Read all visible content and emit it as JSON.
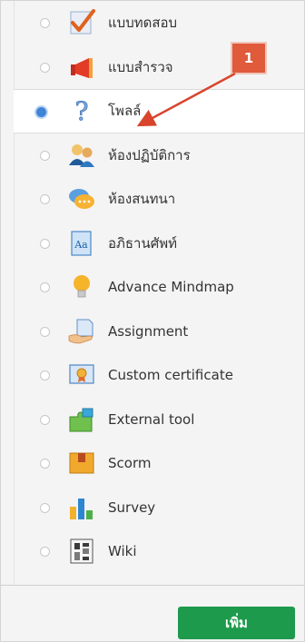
{
  "modules": [
    {
      "label": "แบบทดสอบ",
      "icon": "quiz-checkmark-icon",
      "selected": false
    },
    {
      "label": "แบบสำรวจ",
      "icon": "feedback-megaphone-icon",
      "selected": false
    },
    {
      "label": "โพลล์",
      "icon": "choice-question-mark-icon",
      "selected": true
    },
    {
      "label": "ห้องปฏิบัติการ",
      "icon": "workshop-people-icon",
      "selected": false
    },
    {
      "label": "ห้องสนทนา",
      "icon": "chat-bubble-icon",
      "selected": false
    },
    {
      "label": "อภิธานศัพท์",
      "icon": "glossary-book-icon",
      "selected": false
    },
    {
      "label": "Advance Mindmap",
      "icon": "mindmap-lightbulb-icon",
      "selected": false
    },
    {
      "label": "Assignment",
      "icon": "assignment-hand-document-icon",
      "selected": false
    },
    {
      "label": "Custom certificate",
      "icon": "certificate-ribbon-icon",
      "selected": false
    },
    {
      "label": "External tool",
      "icon": "external-tool-puzzle-icon",
      "selected": false
    },
    {
      "label": "Scorm",
      "icon": "scorm-package-icon",
      "selected": false
    },
    {
      "label": "Survey",
      "icon": "survey-bar-chart-icon",
      "selected": false
    },
    {
      "label": "Wiki",
      "icon": "wiki-pages-icon",
      "selected": false
    }
  ],
  "footer": {
    "add_label": "เพิ่ม"
  },
  "annotation": {
    "number": "1"
  },
  "colors": {
    "accent_green": "#1e9a4c",
    "callout_red": "#e05a3c",
    "radio_selected": "#3f84d6"
  }
}
